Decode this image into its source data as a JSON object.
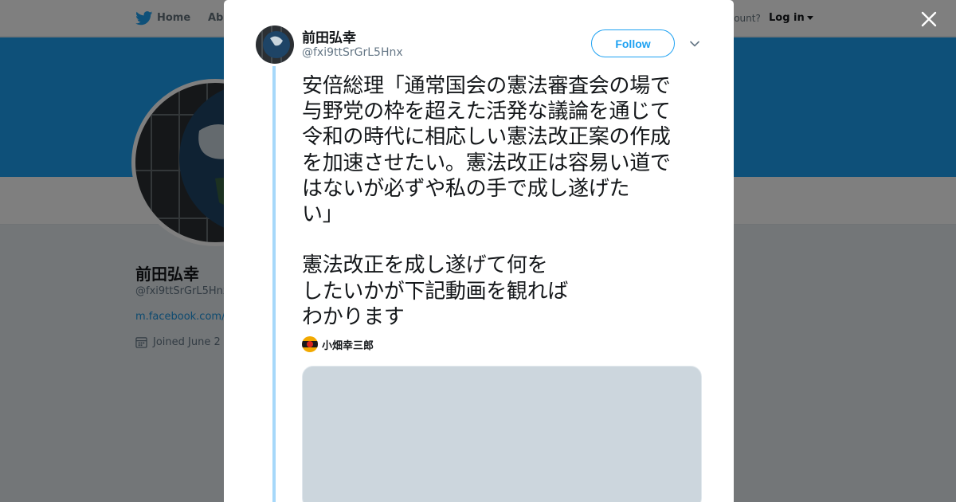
{
  "background_page": {
    "nav": {
      "home_label": "Home",
      "about_label": "Abo",
      "account_prompt": "ccount?",
      "login_label": "Log in"
    },
    "profile": {
      "name": "前田弘幸",
      "handle": "@fxi9ttSrGrL5Hnx",
      "link": "m.facebook.com/…",
      "joined": "Joined June 2"
    }
  },
  "modal": {
    "author": {
      "name": "前田弘幸",
      "handle": "@fxi9ttSrGrL5Hnx"
    },
    "follow_label": "Follow",
    "tweet_lines": [
      "安倍総理「通常国会の憲法審査会の場で",
      "与野党の枠を超えた活発な議論を通じて",
      "令和の時代に相応しい憲法改正案の作成",
      "を加速させたい。憲法改正は容易い道で",
      "はないが必ずや私の手で成し遂げた",
      "い」",
      "",
      "憲法改正を成し遂げて何を",
      "したいかが下記動画を観れば",
      "わかります"
    ],
    "quoted_author": "小畑幸三郎"
  },
  "colors": {
    "accent": "#1da1f2",
    "thread_line": "#a6d8fa",
    "media_placeholder": "#ccd6dd"
  },
  "icons": [
    "twitter-bird-icon",
    "close-icon",
    "chevron-down-icon",
    "calendar-icon"
  ]
}
